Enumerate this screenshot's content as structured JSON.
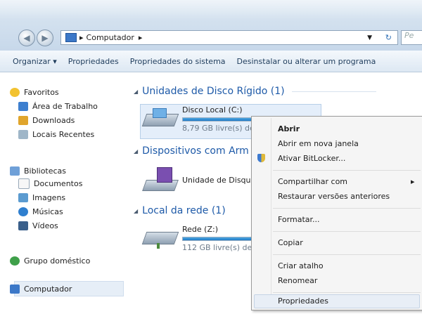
{
  "address": {
    "icon": "computer-icon",
    "crumb": "Computador",
    "search_placeholder": "Pe"
  },
  "toolbar": {
    "organize": "Organizar ▾",
    "properties": "Propriedades",
    "system_properties": "Propriedades do sistema",
    "uninstall": "Desinstalar ou alterar um programa"
  },
  "sidebar": {
    "favorites": "Favoritos",
    "desktop": "Área de Trabalho",
    "downloads": "Downloads",
    "recent": "Locais Recentes",
    "libraries": "Bibliotecas",
    "documents": "Documentos",
    "images": "Imagens",
    "music": "Músicas",
    "videos": "Vídeos",
    "homegroup": "Grupo doméstico",
    "computer": "Computador"
  },
  "main": {
    "group_hdd": "Unidades de Disco Rígido (1)",
    "group_removable": "Dispositivos com Arm",
    "group_network": "Local da rede (1)",
    "drive_c": {
      "name": "Disco Local (C:)",
      "free": "8,79 GB livre(s) de",
      "used_fraction": 0.9
    },
    "drive_dvd": {
      "name": "Unidade de Disque"
    },
    "drive_z": {
      "name": "Rede (Z:)",
      "free": "112 GB livre(s) de 2",
      "used_fraction": 0.85
    }
  },
  "context_menu": {
    "open": "Abrir",
    "open_new_window": "Abrir em nova janela",
    "bitlocker": "Ativar BitLocker...",
    "share_with": "Compartilhar com",
    "restore": "Restaurar versões anteriores",
    "format": "Formatar...",
    "copy": "Copiar",
    "create_shortcut": "Criar atalho",
    "rename": "Renomear",
    "properties": "Propriedades",
    "submenu_arrow": "▸"
  },
  "colors": {
    "accent": "#1e5aa8",
    "selection": "#e4eefa",
    "menu_bg": "#f5f5f5"
  }
}
